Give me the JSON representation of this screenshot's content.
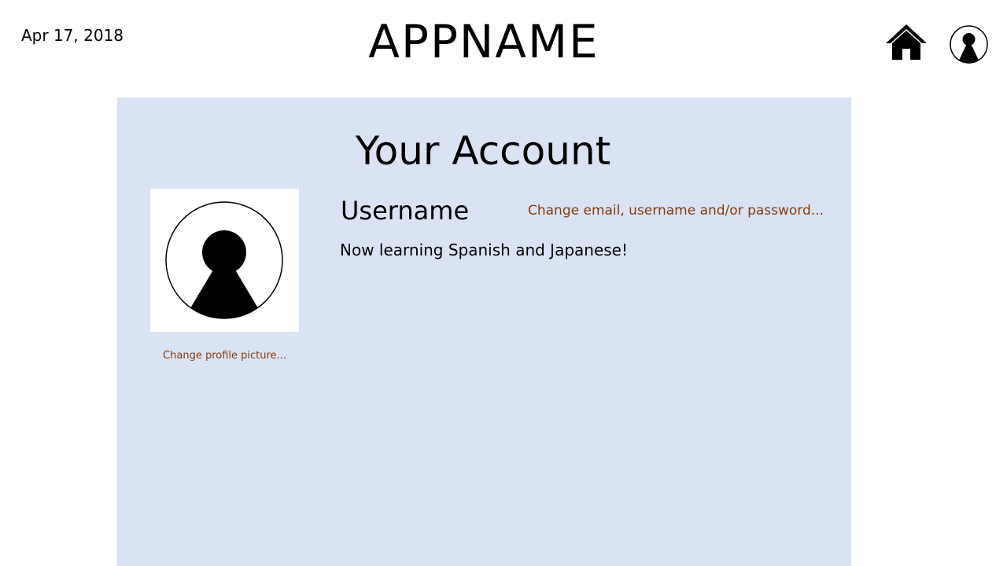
{
  "header": {
    "date": "Apr 17, 2018",
    "app_name": "APPNAME",
    "home_icon": "home-icon",
    "profile_icon": "user-circle-icon"
  },
  "account": {
    "title": "Your Account",
    "username": "Username",
    "bio": "Now learning Spanish and Japanese!",
    "change_picture_label": "Change profile picture...",
    "change_account_label": "Change email, username and/or password...",
    "avatar_icon": "user-silhouette-icon"
  },
  "colors": {
    "panel_background": "#dae3f3",
    "link_color": "#843c0c",
    "text_color": "#000000"
  }
}
